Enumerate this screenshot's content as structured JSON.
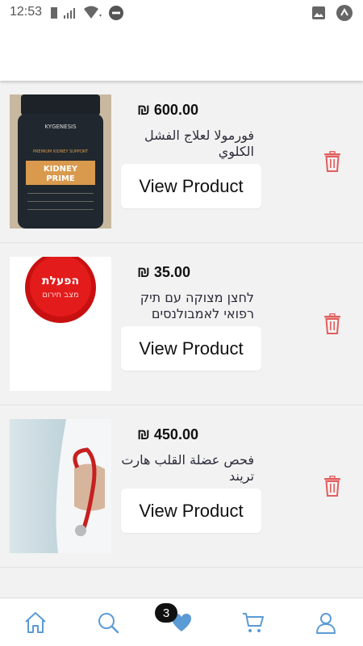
{
  "status_bar": {
    "time": "12:53",
    "icons_left": [
      "sim-card-icon",
      "signal-icon",
      "wifi-icon",
      "do-not-disturb-icon"
    ],
    "icons_right": [
      "image-notification-icon",
      "app-notification-icon"
    ]
  },
  "products": [
    {
      "price": "₪ 600.00",
      "title": "فورمولا لعلاج الفشل الكلوي",
      "button_label": "View Product",
      "image": {
        "brand": "KYGENESIS",
        "tagline": "PREMIUM KIDNEY SUPPORT",
        "name_line1": "KIDNEY",
        "name_line2": "PRIME"
      }
    },
    {
      "price": "₪ 35.00",
      "title": "לחצן מצוקה עם תיק רפואי לאמבולנסים",
      "button_label": "View Product",
      "image": {
        "line1": "הפעלת",
        "line2": "מצב חירום"
      }
    },
    {
      "price": "₪ 450.00",
      "title": "فحص عضلة القلب هارت تريند",
      "button_label": "View Product",
      "image": {}
    }
  ],
  "bottom_nav": {
    "items": [
      "home-icon",
      "search-icon",
      "heart-icon",
      "cart-icon",
      "profile-icon"
    ],
    "favorites_count": "3"
  },
  "colors": {
    "accent": "#5b9bd5",
    "delete": "#e35d5d",
    "list_background": "#f2f2f2"
  }
}
